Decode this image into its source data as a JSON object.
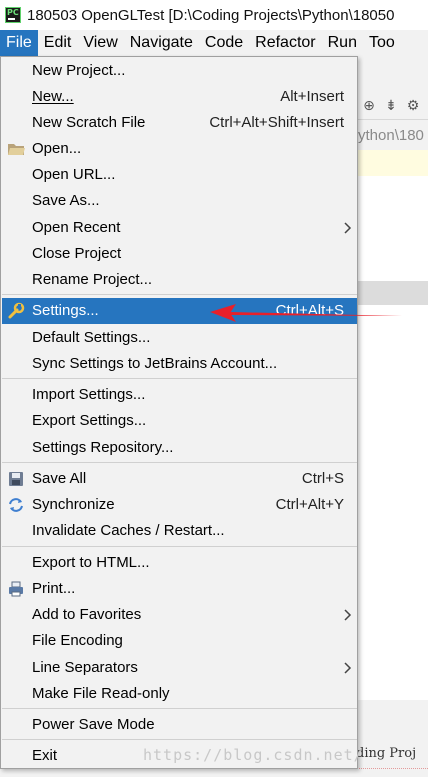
{
  "window": {
    "title": "180503 OpenGLTest [D:\\Coding Projects\\Python\\18050"
  },
  "menubar": [
    "File",
    "Edit",
    "View",
    "Navigate",
    "Code",
    "Refactor",
    "Run",
    "Too"
  ],
  "background": {
    "path_fragment": "ython\\180",
    "console_fragment": "ding Proj"
  },
  "menu": {
    "new_project": "New Project...",
    "new": "New...",
    "new_shortcut": "Alt+Insert",
    "new_scratch": "New Scratch File",
    "new_scratch_shortcut": "Ctrl+Alt+Shift+Insert",
    "open": "Open...",
    "open_url": "Open URL...",
    "save_as": "Save As...",
    "open_recent": "Open Recent",
    "close_project": "Close Project",
    "rename_project": "Rename Project...",
    "settings": "Settings...",
    "settings_shortcut": "Ctrl+Alt+S",
    "default_settings": "Default Settings...",
    "sync_settings": "Sync Settings to JetBrains Account...",
    "import_settings": "Import Settings...",
    "export_settings": "Export Settings...",
    "settings_repo": "Settings Repository...",
    "save_all": "Save All",
    "save_all_shortcut": "Ctrl+S",
    "synchronize": "Synchronize",
    "synchronize_shortcut": "Ctrl+Alt+Y",
    "invalidate": "Invalidate Caches / Restart...",
    "export_html": "Export to HTML...",
    "print": "Print...",
    "add_favorites": "Add to Favorites",
    "file_encoding": "File Encoding",
    "line_separators": "Line Separators",
    "make_readonly": "Make File Read-only",
    "power_save": "Power Save Mode",
    "exit": "Exit"
  },
  "watermark": "https://blog.csdn.net/",
  "colors": {
    "selection": "#2675bf",
    "annotation_arrow": "#e8202a"
  }
}
